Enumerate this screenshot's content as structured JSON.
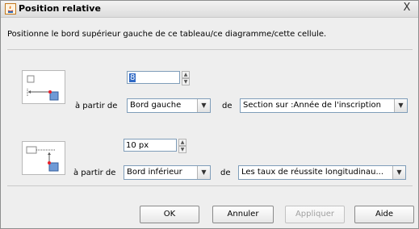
{
  "window": {
    "title": "Position relative",
    "close_symbol": "X"
  },
  "instruction": "Positionne le bord supérieur gauche de ce tableau/ce diagramme/cette cellule.",
  "horizontal": {
    "icon": "horizontal-offset-diagram-icon",
    "value": "8",
    "from_label": "à partir de",
    "edge": "Bord gauche",
    "of_label": "de",
    "reference": "Section sur :Année de l'inscription"
  },
  "vertical": {
    "icon": "vertical-offset-diagram-icon",
    "value": "10 px",
    "from_label": "à partir de",
    "edge": "Bord inférieur",
    "of_label": "de",
    "reference": "Les taux de réussite longitudinau..."
  },
  "buttons": {
    "ok": "OK",
    "cancel": "Annuler",
    "apply": "Appliquer",
    "help": "Aide"
  },
  "colors": {
    "accent_red": "#e8202a",
    "accent_blue": "#6f9ad6",
    "field_border": "#7f9db9",
    "selection": "#316ac5"
  }
}
